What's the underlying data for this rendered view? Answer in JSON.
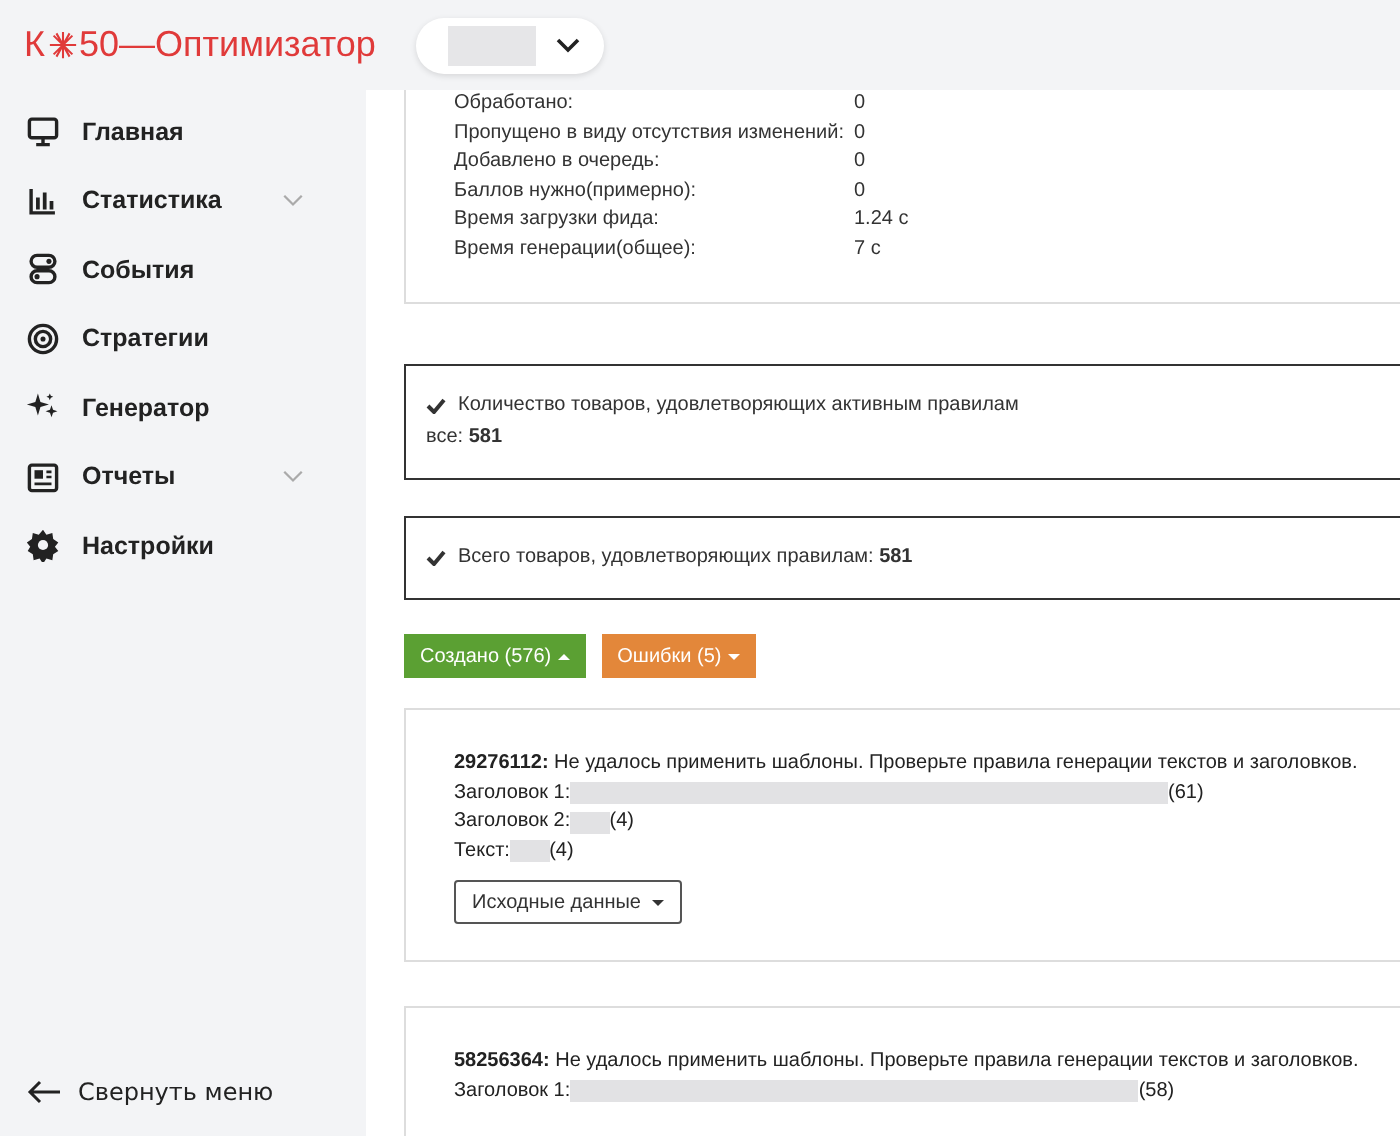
{
  "logo": {
    "prefix": "К",
    "suffix": "50—Оптимизатор"
  },
  "sidebar": {
    "items": [
      {
        "label": "Главная",
        "has_submenu": false
      },
      {
        "label": "Статистика",
        "has_submenu": true
      },
      {
        "label": "События",
        "has_submenu": false
      },
      {
        "label": "Стратегии",
        "has_submenu": false
      },
      {
        "label": "Генератор",
        "has_submenu": false
      },
      {
        "label": "Отчеты",
        "has_submenu": true
      },
      {
        "label": "Настройки",
        "has_submenu": false
      }
    ],
    "collapse": "Свернуть меню"
  },
  "stats": [
    {
      "label": "Обработано:",
      "value": "0"
    },
    {
      "label": "Пропущено в виду отсутствия изменений:",
      "value": "0"
    },
    {
      "label": "Добавлено в очередь:",
      "value": "0"
    },
    {
      "label": "Баллов нужно(примерно):",
      "value": "0"
    },
    {
      "label": "Время загрузки фида:",
      "value": "1.24 с"
    },
    {
      "label": "Время генерации(общее):",
      "value": "7 с"
    }
  ],
  "summaries": [
    {
      "lines": [
        "Количество товаров, удовлетворяющих активным правилам",
        "все: **581**"
      ]
    },
    {
      "lines": [
        "Всего товаров, удовлетворяющих правилам: **581**"
      ]
    }
  ],
  "filter_buttons": [
    {
      "label": "Создано (576)",
      "kind": "success",
      "expanded": true
    },
    {
      "label": "Ошибки (5)",
      "kind": "warning",
      "expanded": false
    }
  ],
  "errors": [
    {
      "id": "29276112:",
      "message": "Не удалось применить шаблоны. Проверьте правила генерации текстов и заголовков.",
      "fields": [
        {
          "label": "Заголовок 1:",
          "count": "(61)"
        },
        {
          "label": "Заголовок 2:",
          "count": "(4)"
        },
        {
          "label": "Текст:",
          "count": "(4)"
        }
      ],
      "source_button": "Исходные данные"
    },
    {
      "id": "58256364:",
      "message": "Не удалось применить шаблоны. Проверьте правила генерации текстов и заголовков.",
      "fields": [
        {
          "label": "Заголовок 1:",
          "count": "(58)"
        }
      ]
    }
  ]
}
